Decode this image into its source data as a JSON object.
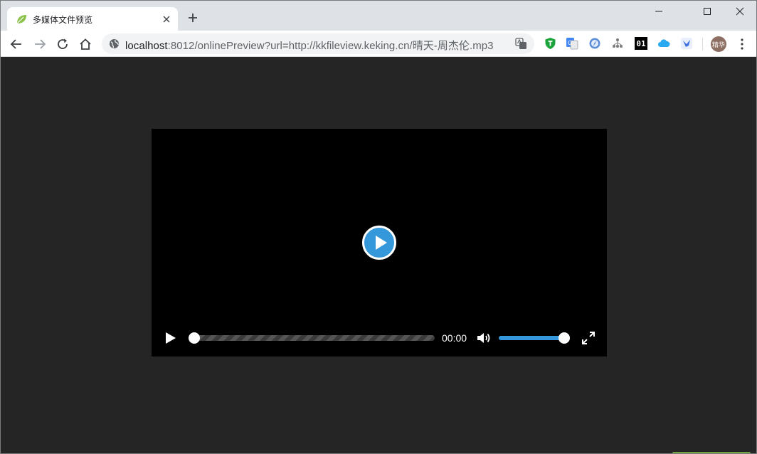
{
  "window": {
    "tab_title": "多媒体文件预览",
    "minimize_glyph": "—",
    "maximize_glyph": "□",
    "close_glyph": "✕"
  },
  "toolbar": {
    "url_host": "localhost",
    "url_rest": ":8012/onlinePreview?url=http://kkfileview.keking.cn/晴天-周杰伦.mp3",
    "avatar_text": "精华",
    "ext_01_text": "01"
  },
  "player": {
    "time": "00:00",
    "progress": 0,
    "volume": 1,
    "accent": "#3498db"
  },
  "icons": {
    "favicon": "leaf-icon",
    "back": "arrow-left-icon",
    "forward": "arrow-right-icon",
    "reload": "reload-icon",
    "home": "home-icon"
  }
}
